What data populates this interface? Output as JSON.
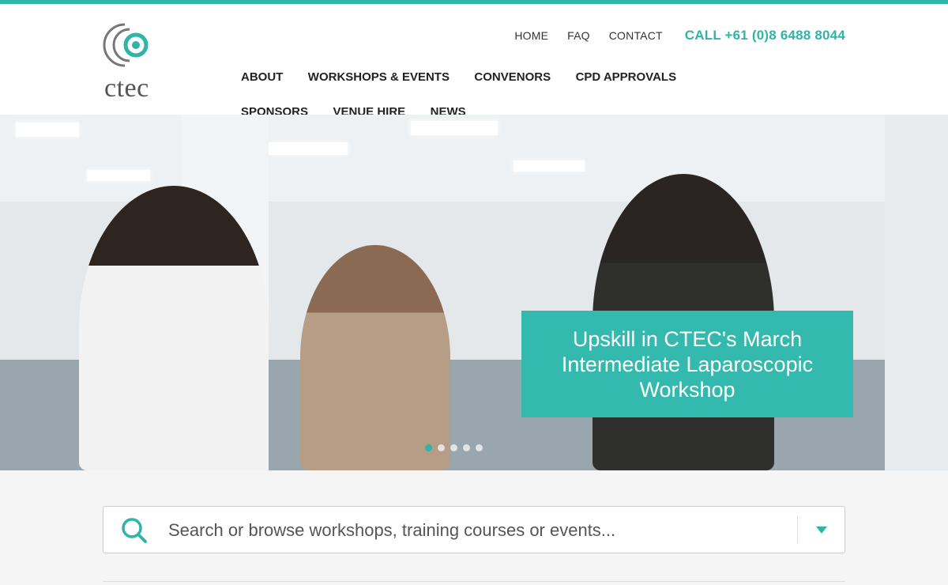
{
  "brand": {
    "name": "ctec",
    "accent": "#32b3a8"
  },
  "utility_nav": {
    "items": [
      "HOME",
      "FAQ",
      "CONTACT"
    ],
    "phone": "CALL +61 (0)8 6488 8044"
  },
  "main_nav": {
    "items": [
      "ABOUT",
      "WORKSHOPS & EVENTS",
      "CONVENORS",
      "CPD APPROVALS",
      "SPONSORS",
      "VENUE HIRE",
      "NEWS"
    ]
  },
  "hero": {
    "caption": "Upskill in CTEC's March Intermediate Laparoscopic Workshop",
    "slide_count": 5,
    "active_slide": 1
  },
  "search": {
    "placeholder": "Search or browse workshops, training courses or events...",
    "icon": "search-icon",
    "toggle_icon": "caret-down-icon"
  }
}
